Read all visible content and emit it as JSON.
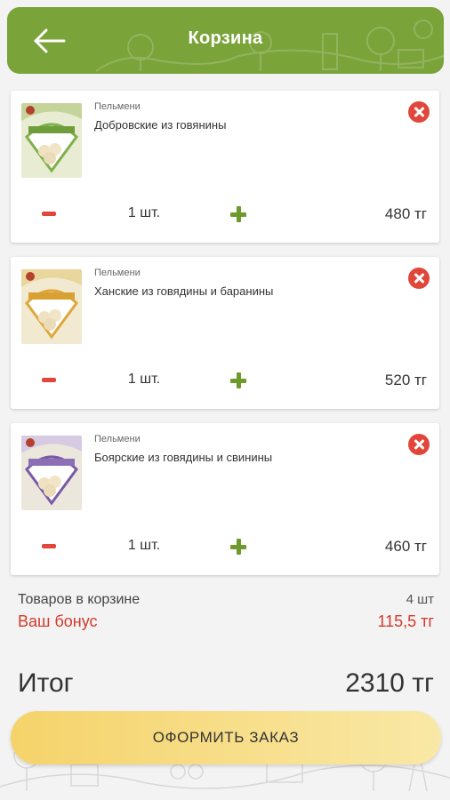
{
  "header": {
    "title": "Корзина",
    "back_icon": "arrow-left-icon"
  },
  "items": [
    {
      "category": "Пельмени",
      "name": "Добровские из говянины",
      "qty": "1 шт.",
      "price": "480 тг"
    },
    {
      "category": "Пельмени",
      "name": "Ханские из говядины и баранины",
      "qty": "1 шт.",
      "price": "520 тг"
    },
    {
      "category": "Пельмени",
      "name": "Боярские из говядины и свинины",
      "qty": "1 шт.",
      "price": "460 тг"
    }
  ],
  "summary": {
    "items_label": "Товаров в корзине",
    "items_value": "4 шт",
    "bonus_label": "Ваш бонус",
    "bonus_value": "115,5 тг",
    "total_label": "Итог",
    "total_value": "2310 тг"
  },
  "order_button": "ОФОРМИТЬ ЗАКАЗ",
  "colors": {
    "header": "#7aa33a",
    "accent_red": "#e0473a",
    "accent_green": "#6e9a2b",
    "button_gradient_start": "#f5d36a"
  }
}
